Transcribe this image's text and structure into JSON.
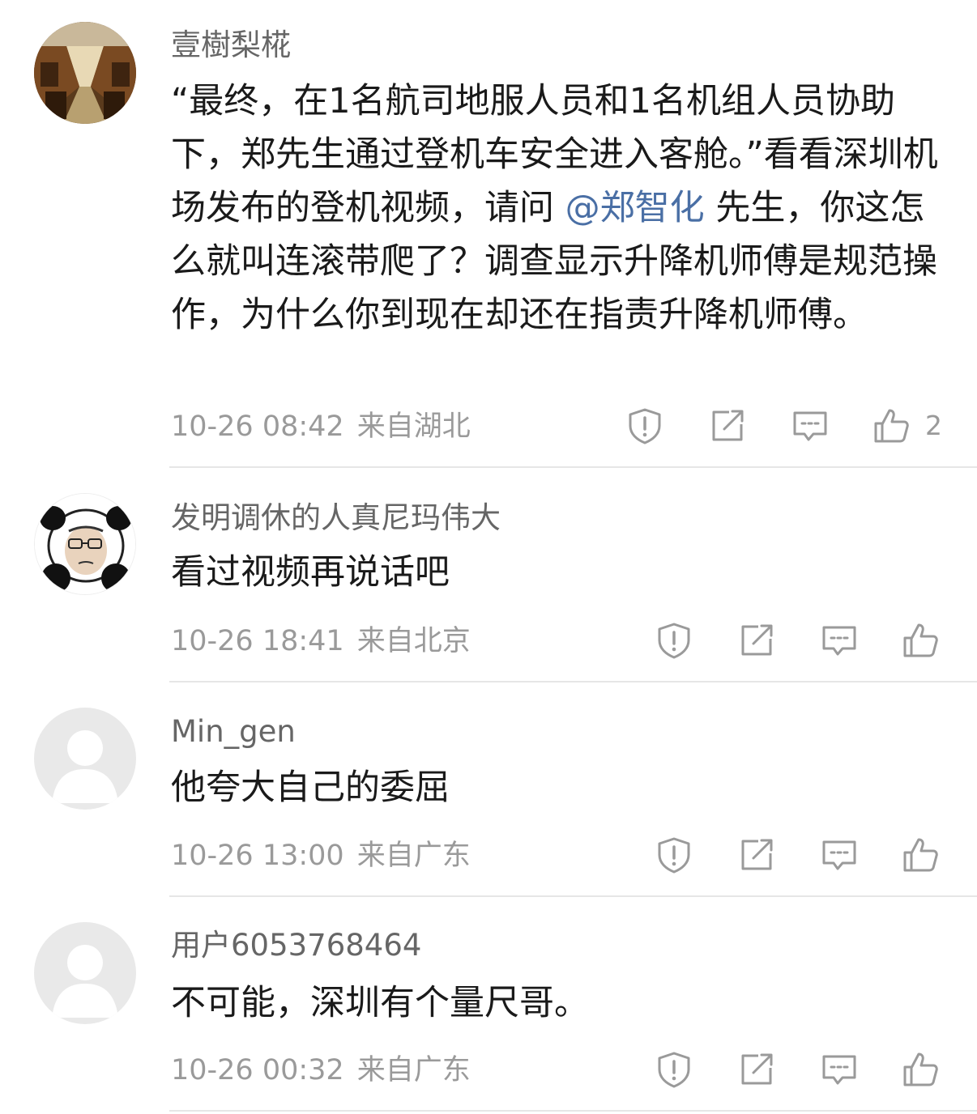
{
  "comments": [
    {
      "username": "壹樹梨椛",
      "text_before": "“最终，在1名航司地服人员和1名机组人员协助下，郑先生通过登机车安全进入客舱。”看看深圳机场发布的登机视频，请问 ",
      "mention": "@郑智化",
      "text_after": " 先生，你这怎么就叫连滚带爬了？调查显示升降机师傅是规范操作，为什么你到现在却还在指责升降机师傅。",
      "date": "10-26 08:42",
      "location": "来自湖北",
      "likes": "2",
      "avatar": "train-interior-photo"
    },
    {
      "username": "发明调休的人真尼玛伟大",
      "text": "看过视频再说话吧",
      "date": "10-26 18:41",
      "location": "来自北京",
      "avatar": "panda-meme"
    },
    {
      "username": "Min_gen",
      "text": "他夸大自己的委屈",
      "date": "10-26 13:00",
      "location": "来自广东",
      "avatar": "default-avatar"
    },
    {
      "username": "用户6053768464",
      "text": "不可能，深圳有个量尺哥。",
      "date": "10-26 00:32",
      "location": "来自广东",
      "avatar": "default-avatar"
    }
  ],
  "icons": {
    "report": "report-icon",
    "forward": "forward-icon",
    "reply": "reply-icon",
    "like": "like-icon"
  },
  "colors": {
    "mention": "#4a6fa5",
    "meta": "#9a9a9a",
    "username": "#666666",
    "text": "#1a1a1a"
  }
}
